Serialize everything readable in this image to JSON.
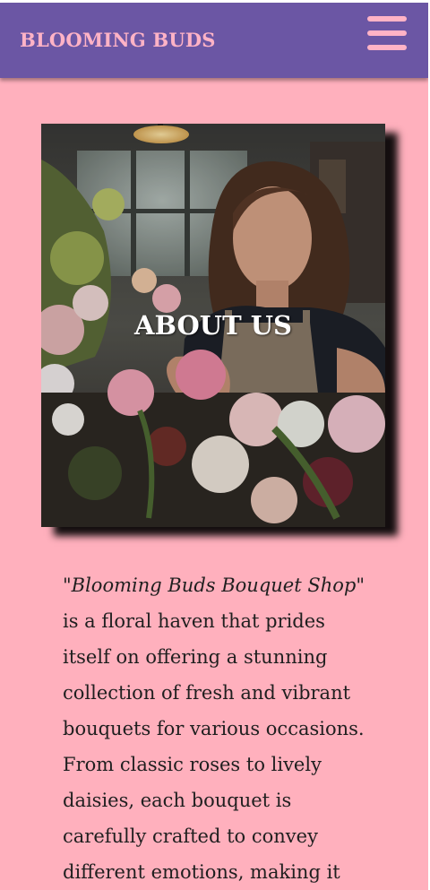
{
  "header": {
    "brand": "BLOOMING BUDS",
    "menu_icon": "hamburger-menu-icon"
  },
  "hero": {
    "title": "ABOUT US"
  },
  "about": {
    "shop_name": "\"Blooming Buds Bouquet Shop\"",
    "description": " is a floral haven that prides itself on offering a stunning collection of fresh and vibrant bouquets for various occasions. From classic roses to lively daisies, each bouquet is carefully crafted to convey different emotions, making it"
  },
  "colors": {
    "page_background": "#ffb0bd",
    "navbar": "#6b56a4",
    "brand_text": "#ffb3c6"
  }
}
